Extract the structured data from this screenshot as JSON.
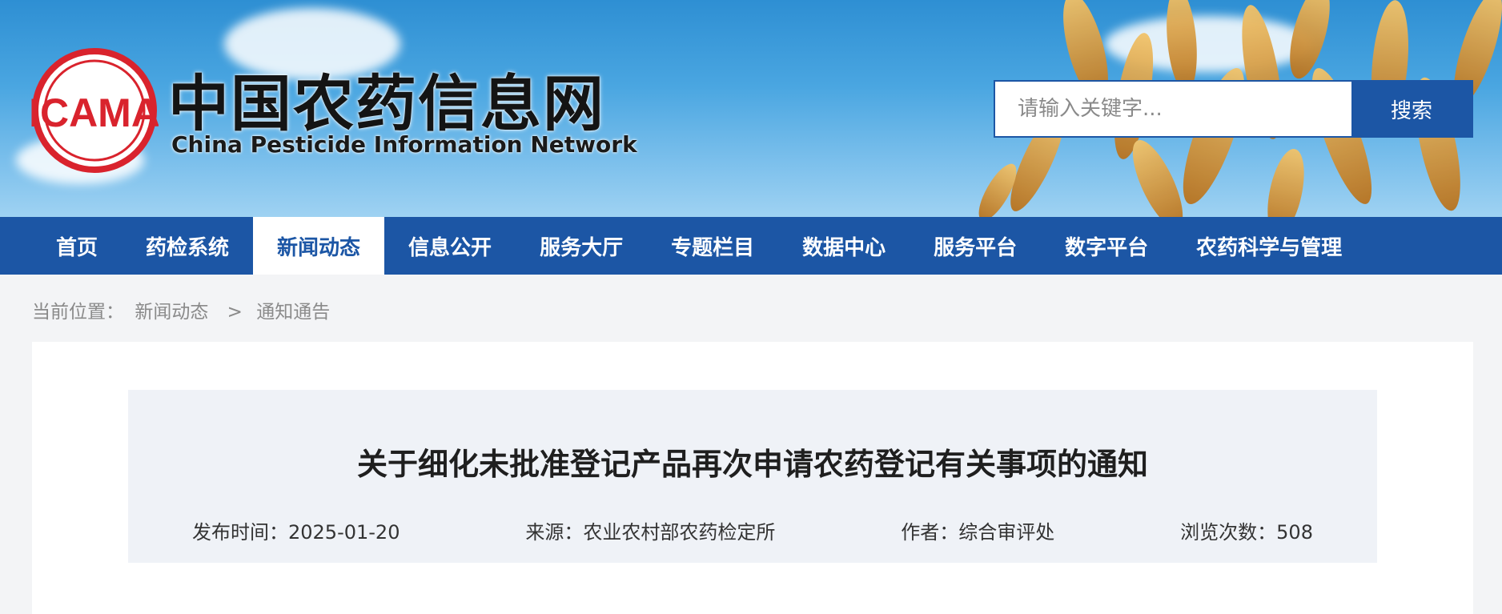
{
  "header": {
    "logo_text": "ICAMA",
    "title_cn": "中国农药信息网",
    "title_en": "China Pesticide Information Network"
  },
  "search": {
    "placeholder": "请输入关键字...",
    "button_label": "搜索"
  },
  "nav": {
    "items": [
      {
        "label": "首页",
        "active": false
      },
      {
        "label": "药检系统",
        "active": false
      },
      {
        "label": "新闻动态",
        "active": true
      },
      {
        "label": "信息公开",
        "active": false
      },
      {
        "label": "服务大厅",
        "active": false
      },
      {
        "label": "专题栏目",
        "active": false
      },
      {
        "label": "数据中心",
        "active": false
      },
      {
        "label": "服务平台",
        "active": false
      },
      {
        "label": "数字平台",
        "active": false
      },
      {
        "label": "农药科学与管理",
        "active": false
      }
    ]
  },
  "breadcrumb": {
    "prefix": "当前位置：",
    "crumb1": "新闻动态",
    "separator": ">",
    "crumb2": "通知通告"
  },
  "article": {
    "title": "关于细化未批准登记产品再次申请农药登记有关事项的通知",
    "publish_time": "发布时间：2025-01-20",
    "source": "来源：农业农村部农药检定所",
    "author": "作者：综合审评处",
    "views": "浏览次数：508"
  },
  "colors": {
    "brand_blue": "#1c56a5",
    "logo_red": "#d9232d"
  }
}
